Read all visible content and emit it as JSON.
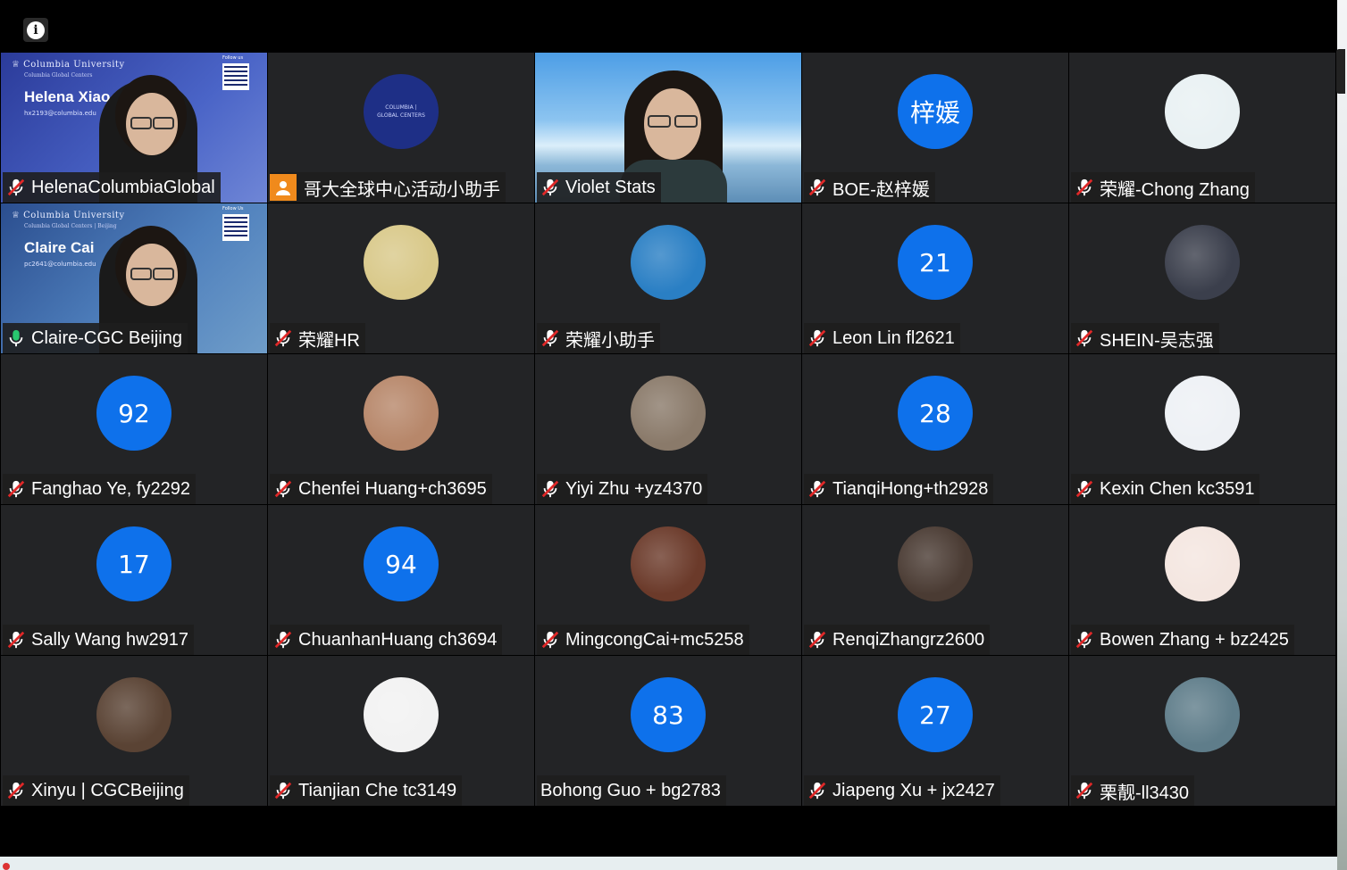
{
  "toolbar": {
    "info_icon": "info-icon"
  },
  "tiles": [
    {
      "name": "HelenaColumbiaGlobal",
      "mic": "muted",
      "type": "video",
      "video": {
        "logo": "Columbia University",
        "sub": "Columbia Global Centers",
        "title": "Helena Xiao",
        "email": "hx2193@columbia.edu",
        "follow": "Follow us"
      }
    },
    {
      "name": "哥大全球中心活动小助手",
      "mic": "app",
      "type": "avatar",
      "avatar_style": "cgc-logo",
      "avatar_text": "COLUMBIA | GLOBAL CENTERS"
    },
    {
      "name": "Violet Stats",
      "mic": "muted",
      "type": "video-sky"
    },
    {
      "name": "BOE-赵梓媛",
      "mic": "muted",
      "type": "avatar",
      "avatar_style": "blue",
      "avatar_text": "梓媛"
    },
    {
      "name": "荣耀-Chong Zhang",
      "mic": "muted",
      "type": "avatar",
      "avatar_style": "photo",
      "avatar_color": "#e9f1f3"
    },
    {
      "name": "Claire-CGC Beijing",
      "mic": "active",
      "type": "video",
      "video": {
        "logo": "Columbia University",
        "sub": "Columbia Global Centers | Beijing",
        "title": "Claire Cai",
        "email": "pc2641@columbia.edu",
        "follow": "Follow Us"
      }
    },
    {
      "name": "荣耀HR",
      "mic": "muted",
      "type": "avatar",
      "avatar_style": "photo",
      "avatar_color": "#d9c98a"
    },
    {
      "name": "荣耀小助手",
      "mic": "muted",
      "type": "avatar",
      "avatar_style": "photo",
      "avatar_color": "#2a7fc4"
    },
    {
      "name": "Leon Lin fl2621",
      "mic": "muted",
      "type": "avatar",
      "avatar_style": "blue",
      "avatar_text": "21"
    },
    {
      "name": "SHEIN-吴志强",
      "mic": "muted",
      "type": "avatar",
      "avatar_style": "photo",
      "avatar_color": "#3b3f4c"
    },
    {
      "name": "Fanghao Ye, fy2292",
      "mic": "muted",
      "type": "avatar",
      "avatar_style": "blue",
      "avatar_text": "92"
    },
    {
      "name": "Chenfei Huang+ch3695",
      "mic": "muted",
      "type": "avatar",
      "avatar_style": "photo",
      "avatar_color": "#b7876a"
    },
    {
      "name": "Yiyi Zhu +yz4370",
      "mic": "muted",
      "type": "avatar",
      "avatar_style": "photo",
      "avatar_color": "#8a7a6a"
    },
    {
      "name": "TianqiHong+th2928",
      "mic": "muted",
      "type": "avatar",
      "avatar_style": "blue",
      "avatar_text": "28"
    },
    {
      "name": "Kexin Chen kc3591",
      "mic": "muted",
      "type": "avatar",
      "avatar_style": "photo",
      "avatar_color": "#eef1f5"
    },
    {
      "name": "Sally Wang hw2917",
      "mic": "muted",
      "type": "avatar",
      "avatar_style": "blue",
      "avatar_text": "17"
    },
    {
      "name": "ChuanhanHuang ch3694",
      "mic": "muted",
      "type": "avatar",
      "avatar_style": "blue",
      "avatar_text": "94"
    },
    {
      "name": "MingcongCai+mc5258",
      "mic": "muted",
      "type": "avatar",
      "avatar_style": "photo",
      "avatar_color": "#6b3a2a"
    },
    {
      "name": "RenqiZhangrz2600",
      "mic": "muted",
      "type": "avatar",
      "avatar_style": "photo",
      "avatar_color": "#4a3b33"
    },
    {
      "name": "Bowen Zhang + bz2425",
      "mic": "muted",
      "type": "avatar",
      "avatar_style": "photo",
      "avatar_color": "#f4e6e0"
    },
    {
      "name": "Xinyu | CGCBeijing",
      "mic": "muted",
      "type": "avatar",
      "avatar_style": "photo",
      "avatar_color": "#5a4334"
    },
    {
      "name": "Tianjian Che tc3149",
      "mic": "muted",
      "type": "avatar",
      "avatar_style": "photo",
      "avatar_color": "#f2f2f2"
    },
    {
      "name": "Bohong Guo + bg2783",
      "mic": "none",
      "type": "avatar",
      "avatar_style": "blue",
      "avatar_text": "83"
    },
    {
      "name": "Jiapeng Xu + jx2427",
      "mic": "muted",
      "type": "avatar",
      "avatar_style": "blue",
      "avatar_text": "27"
    },
    {
      "name": "栗靓-ll3430",
      "mic": "muted",
      "type": "avatar",
      "avatar_style": "photo",
      "avatar_color": "#5f7d8a"
    }
  ]
}
